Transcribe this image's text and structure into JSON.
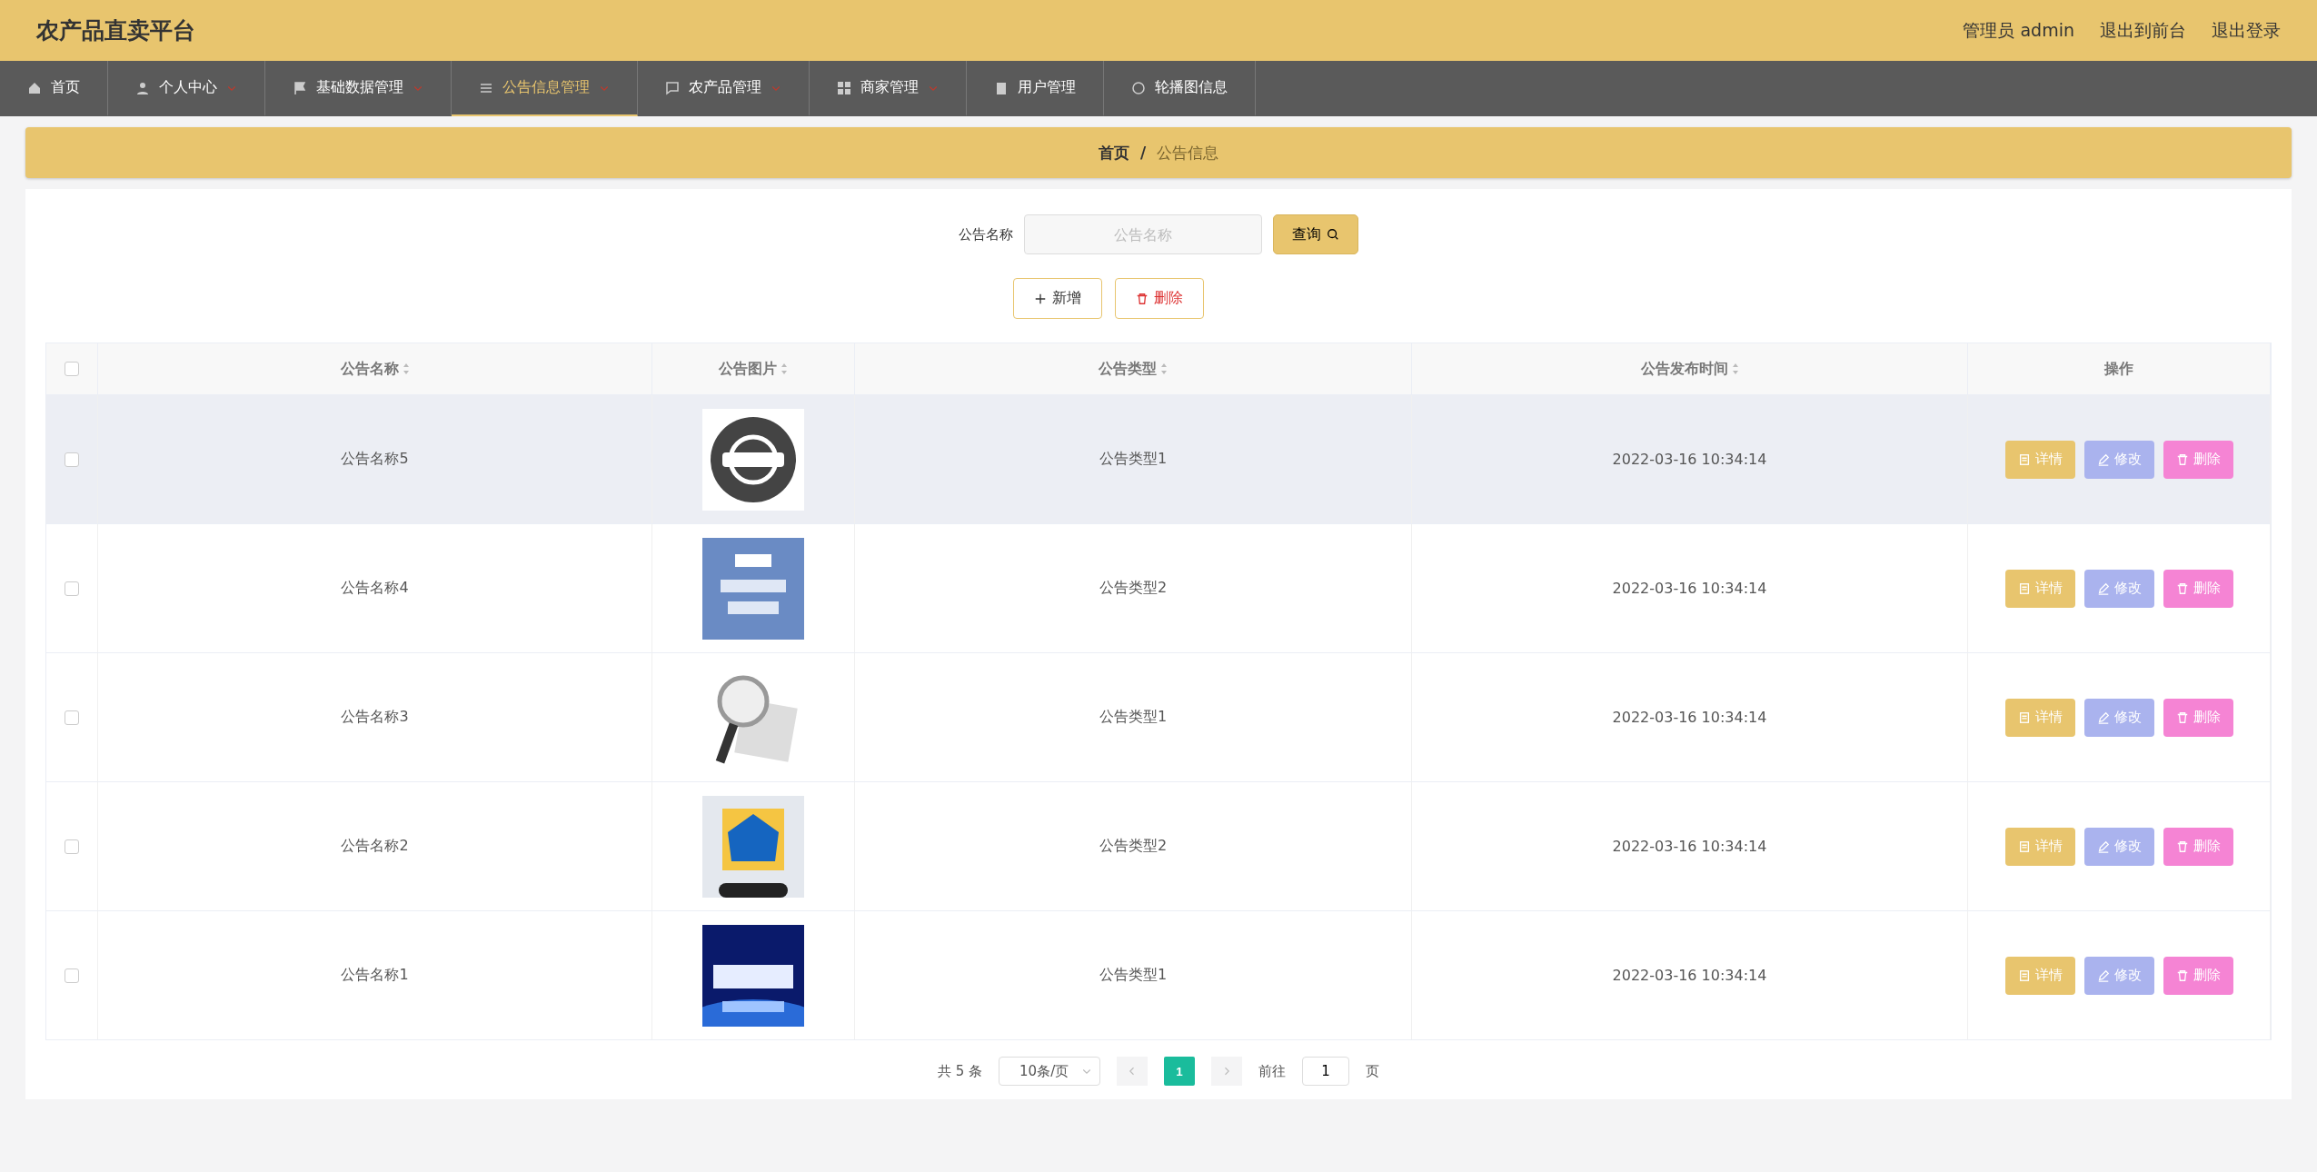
{
  "header": {
    "title": "农产品直卖平台",
    "user": "管理员 admin",
    "links": [
      "退出到前台",
      "退出登录"
    ]
  },
  "nav": [
    {
      "label": "首页",
      "dropdown": false,
      "selected": false
    },
    {
      "label": "个人中心",
      "dropdown": true,
      "selected": false
    },
    {
      "label": "基础数据管理",
      "dropdown": true,
      "selected": false
    },
    {
      "label": "公告信息管理",
      "dropdown": true,
      "selected": true
    },
    {
      "label": "农产品管理",
      "dropdown": true,
      "selected": false
    },
    {
      "label": "商家管理",
      "dropdown": true,
      "selected": false
    },
    {
      "label": "用户管理",
      "dropdown": false,
      "selected": false
    },
    {
      "label": "轮播图信息",
      "dropdown": false,
      "selected": false
    }
  ],
  "breadcrumb": [
    "首页",
    "/",
    "公告信息"
  ],
  "search": {
    "label": "公告名称",
    "placeholder": "公告名称",
    "button": "查询"
  },
  "actions": {
    "add": "新增",
    "delete": "删除"
  },
  "table": {
    "all_checked": false,
    "columns": [
      {
        "label": "公告名称",
        "sortable": true
      },
      {
        "label": "公告图片",
        "sortable": true
      },
      {
        "label": "公告类型",
        "sortable": true
      },
      {
        "label": "公告发布时间",
        "sortable": true
      },
      {
        "label": "操作",
        "sortable": false
      }
    ],
    "rows": [
      {
        "name": "公告名称5",
        "type": "公告类型1",
        "time": "2022-03-16 10:34:14",
        "checked": false,
        "highlighted": true,
        "buttons": [
          "详情",
          "修改",
          "删除"
        ]
      },
      {
        "name": "公告名称4",
        "type": "公告类型2",
        "time": "2022-03-16 10:34:14",
        "checked": false,
        "highlighted": false,
        "buttons": [
          "详情",
          "修改",
          "删除"
        ]
      },
      {
        "name": "公告名称3",
        "type": "公告类型1",
        "time": "2022-03-16 10:34:14",
        "checked": false,
        "highlighted": false,
        "buttons": [
          "详情",
          "修改",
          "删除"
        ]
      },
      {
        "name": "公告名称2",
        "type": "公告类型2",
        "time": "2022-03-16 10:34:14",
        "checked": false,
        "highlighted": false,
        "buttons": [
          "详情",
          "修改",
          "删除"
        ]
      },
      {
        "name": "公告名称1",
        "type": "公告类型1",
        "time": "2022-03-16 10:34:14",
        "checked": false,
        "highlighted": false,
        "buttons": [
          "详情",
          "修改",
          "删除"
        ]
      }
    ]
  },
  "pagination": {
    "total": "共 5 条",
    "page_size": "10条/页",
    "pages": [
      {
        "label": "1",
        "selected": true
      }
    ],
    "goto_label": "前往",
    "goto_value": "1",
    "goto_suffix": "页"
  }
}
